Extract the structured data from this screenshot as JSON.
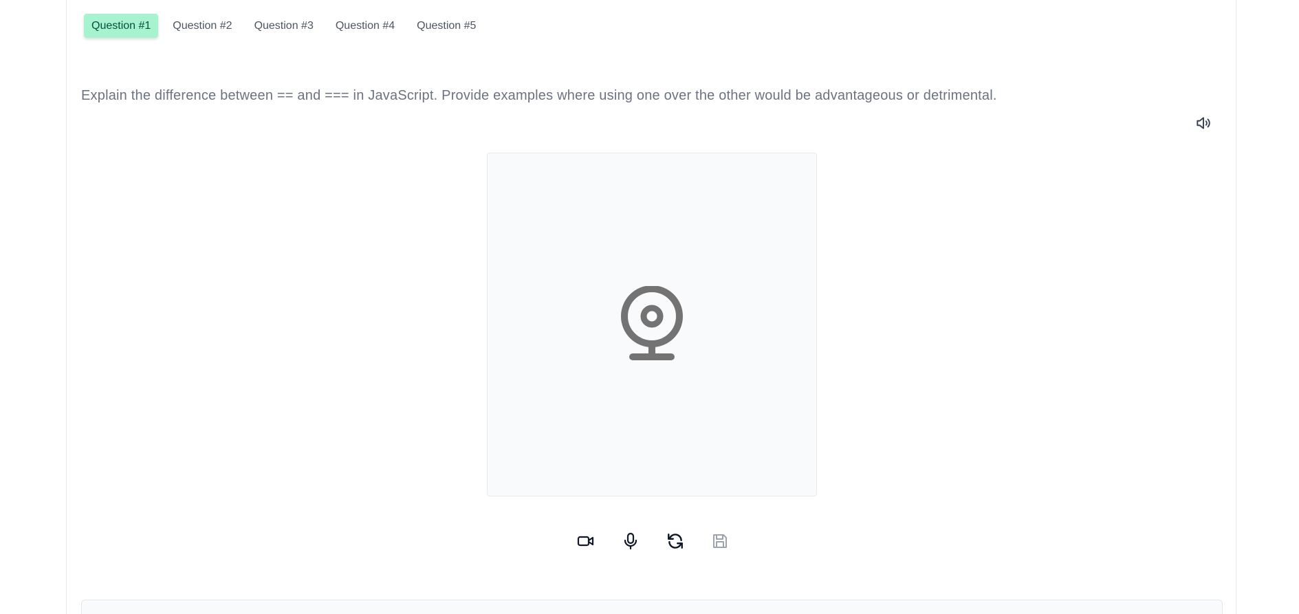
{
  "tabs": [
    {
      "label": "Question #1",
      "active": true
    },
    {
      "label": "Question #2",
      "active": false
    },
    {
      "label": "Question #3",
      "active": false
    },
    {
      "label": "Question #4",
      "active": false
    },
    {
      "label": "Question #5",
      "active": false
    }
  ],
  "question": {
    "text": "Explain the difference between == and === in JavaScript. Provide examples where using one over the other would be advantageous or detrimental."
  },
  "icons": {
    "speaker": "speaker-icon",
    "webcam": "webcam-icon",
    "video": "video-camera-icon",
    "microphone": "microphone-icon",
    "refresh": "refresh-icon",
    "save": "save-icon"
  },
  "colors": {
    "active_tab_bg": "#a7f3d0",
    "active_tab_text": "#064e3b",
    "tab_text": "#4b5563",
    "question_text": "#6b7280",
    "webcam_icon": "#737373",
    "control_icon": "#111827",
    "save_icon_disabled": "#9ca3af"
  }
}
